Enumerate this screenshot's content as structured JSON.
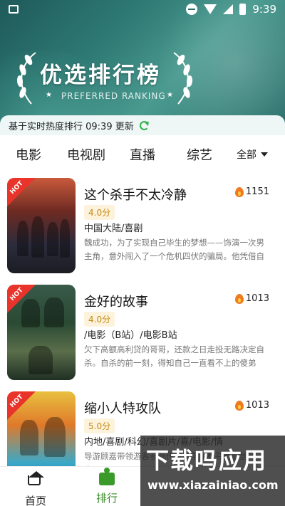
{
  "status_bar": {
    "time": "9:39"
  },
  "banner": {
    "title": "优选排行榜",
    "subtitle": "PREFERRED RANKING"
  },
  "update": {
    "text": "基于实时热度排行 09:39 更新"
  },
  "tabs": {
    "movie": "电影",
    "tv": "电视剧",
    "live": "直播",
    "variety": "综艺",
    "all": "全部"
  },
  "items": [
    {
      "badge": "HOT",
      "title": "这个杀手不太冷静",
      "heat": "1151",
      "score": "4.0分",
      "genre": "中国大陆/喜剧",
      "desc": "魏成功，为了实现自己毕生的梦想——饰演一次男主角，意外闯入了一个危机四伏的骗局。他凭借自己…"
    },
    {
      "badge": "HOT",
      "title": "金好的故事",
      "heat": "1013",
      "score": "4.0分",
      "genre": "/电影（B站）/电影B站",
      "desc": "欠下高额高利贷的哥哥，还款之日走投无路决定自杀。自杀的前一刻，得知自己一直看不上的傻弟弟…"
    },
    {
      "badge": "HOT",
      "title": "缩小人特攻队",
      "heat": "1013",
      "score": "5.0分",
      "genre": "内地/喜剧/科幻/喜剧片/喜/电影/情",
      "desc": "导游顾嘉带领游客参观传奇科学家杜芬奇旧居时，意…"
    }
  ],
  "bottom_nav": {
    "home": "首页",
    "rank": "排行"
  },
  "watermark": {
    "main": "下载吗应用",
    "url": "www.xiazainiao.com"
  },
  "colors": {
    "accent": "#3a9a2a",
    "hot": "#e8342a",
    "score_text": "#c48a14"
  }
}
